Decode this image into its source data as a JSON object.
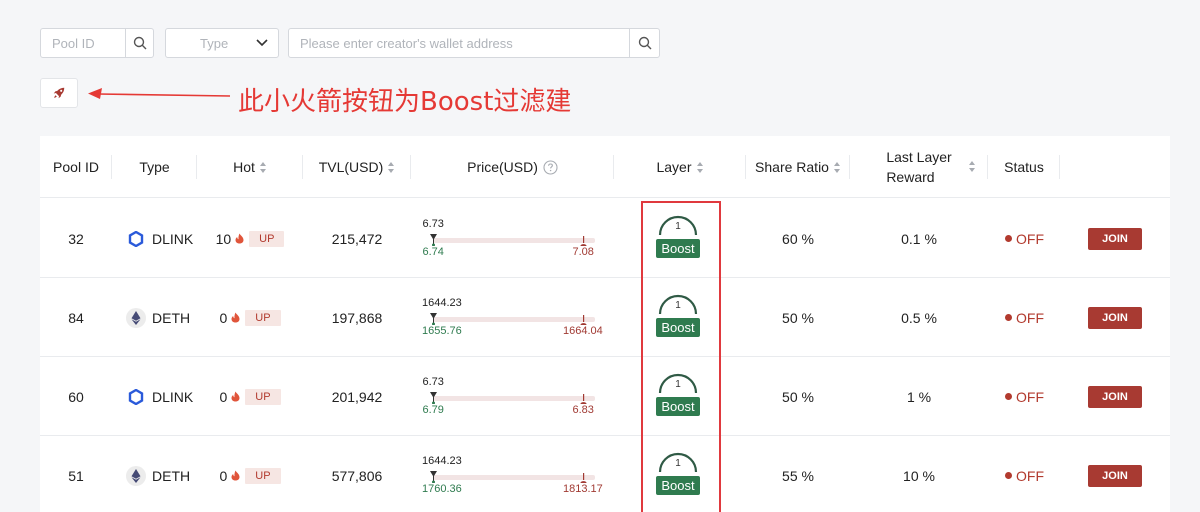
{
  "filters": {
    "pool_id_placeholder": "Pool ID",
    "type_placeholder": "Type",
    "wallet_placeholder": "Please enter creator's wallet address"
  },
  "annotation": {
    "text": "此小火箭按钮为Boost过滤建"
  },
  "table": {
    "headers": {
      "pool_id": "Pool ID",
      "type": "Type",
      "hot": "Hot",
      "tvl": "TVL(USD)",
      "price": "Price(USD)",
      "layer": "Layer",
      "share_ratio": "Share Ratio",
      "last_layer_reward_line1": "Last Layer",
      "last_layer_reward_line2": "Reward",
      "status": "Status"
    },
    "rows": [
      {
        "pool_id": "32",
        "type": "DLINK",
        "type_icon": "chainlink-icon",
        "hot": "10",
        "up": "UP",
        "tvl": "215,472",
        "price_current": "6.73",
        "price_low": "6.74",
        "price_high": "7.08",
        "layer": "1",
        "boost": "Boost",
        "share_ratio": "60 %",
        "last_reward": "0.1 %",
        "status": "OFF",
        "join": "JOIN"
      },
      {
        "pool_id": "84",
        "type": "DETH",
        "type_icon": "ethereum-icon",
        "hot": "0",
        "up": "UP",
        "tvl": "197,868",
        "price_current": "1644.23",
        "price_low": "1655.76",
        "price_high": "1664.04",
        "layer": "1",
        "boost": "Boost",
        "share_ratio": "50 %",
        "last_reward": "0.5 %",
        "status": "OFF",
        "join": "JOIN"
      },
      {
        "pool_id": "60",
        "type": "DLINK",
        "type_icon": "chainlink-icon",
        "hot": "0",
        "up": "UP",
        "tvl": "201,942",
        "price_current": "6.73",
        "price_low": "6.79",
        "price_high": "6.83",
        "layer": "1",
        "boost": "Boost",
        "share_ratio": "50 %",
        "last_reward": "1 %",
        "status": "OFF",
        "join": "JOIN"
      },
      {
        "pool_id": "51",
        "type": "DETH",
        "type_icon": "ethereum-icon",
        "hot": "0",
        "up": "UP",
        "tvl": "577,806",
        "price_current": "1644.23",
        "price_low": "1760.36",
        "price_high": "1813.17",
        "layer": "1",
        "boost": "Boost",
        "share_ratio": "55 %",
        "last_reward": "10 %",
        "status": "OFF",
        "join": "JOIN"
      }
    ]
  },
  "colors": {
    "background": "#f5f6f8",
    "accent_red": "#a83a32",
    "boost_green": "#2f7b4f",
    "annotation_red": "#e53935"
  }
}
